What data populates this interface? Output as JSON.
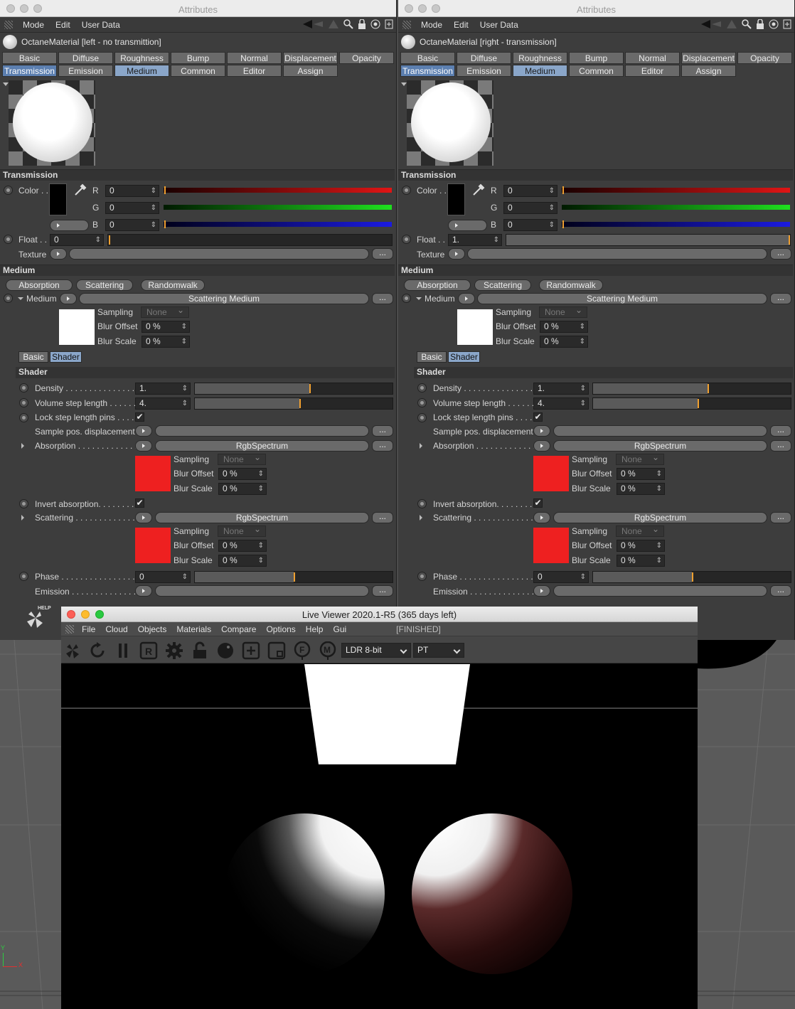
{
  "window_title": "Attributes",
  "menu": [
    "Mode",
    "Edit",
    "User Data"
  ],
  "tabs_row1": [
    "Basic",
    "Diffuse",
    "Roughness",
    "Bump",
    "Normal",
    "Displacement",
    "Opacity"
  ],
  "tabs_row2": [
    "Transmission",
    "Emission",
    "Medium",
    "Common",
    "Editor",
    "Assign"
  ],
  "sections": {
    "transmission": "Transmission",
    "medium": "Medium",
    "shader": "Shader"
  },
  "labels": {
    "color": "Color . .",
    "r": "R",
    "g": "G",
    "b": "B",
    "float": "Float . .",
    "texture": "Texture",
    "medium": "Medium",
    "scattering_medium": "Scattering Medium",
    "sampling": "Sampling",
    "blur_offset": "Blur Offset",
    "blur_scale": "Blur Scale",
    "none": "None",
    "pct0": "0 %",
    "density": "Density . . . . . . . . . . . . . . . .",
    "volume_step": "Volume step length . . . . . .",
    "lock_step": "Lock step length pins . . . .",
    "sample_pos": "Sample pos. displacement",
    "absorption": "Absorption . . . . . . . . . . . . .",
    "invert_absorption": "Invert absorption. . . . . . . .",
    "scattering": "Scattering . . . . . . . . . . . . .",
    "rgbspectrum": "RgbSpectrum",
    "phase": "Phase . . . . . . . . . . . . . . . . .",
    "emission": "Emission . . . . . . . . . . . . . . .",
    "dots": "...",
    "checkmark": "✔",
    "help": "HELP"
  },
  "medium_buttons": [
    "Absorption",
    "Scattering",
    "Randomwalk"
  ],
  "shader_tabs": [
    "Basic",
    "Shader"
  ],
  "left": {
    "object": "OctaneMaterial [left - no transmittion]",
    "r": "0",
    "g": "0",
    "b": "0",
    "float": "0",
    "float_level": 0,
    "density": "1.",
    "density_level": 0.58,
    "volume_step": "4.",
    "volume_step_level": 0.53,
    "phase": "0",
    "phase_level": 0.5
  },
  "right": {
    "object": "OctaneMaterial [right - transmission]",
    "r": "0",
    "g": "0",
    "b": "0",
    "float": "1.",
    "float_level": 1,
    "density": "1.",
    "density_level": 0.58,
    "volume_step": "4.",
    "volume_step_level": 0.53,
    "phase": "0",
    "phase_level": 0.5
  },
  "live_viewer": {
    "title": "Live Viewer 2020.1-R5 (365 days left)",
    "menu": [
      "File",
      "Cloud",
      "Objects",
      "Materials",
      "Compare",
      "Options",
      "Help",
      "Gui"
    ],
    "status": "[FINISHED]",
    "tonemap": "LDR 8-bit",
    "kernel": "PT",
    "icons": [
      "octane-logo-icon",
      "refresh-icon",
      "pause-icon",
      "region-render-icon",
      "settings-gear-icon",
      "lock-icon",
      "material-ball-icon",
      "add-region-icon",
      "crop-icon",
      "focus-picker-icon",
      "material-picker-icon"
    ]
  },
  "axis": {
    "y": "Y",
    "x": "X"
  },
  "colors": {
    "accent_tab": "#8aa6c9",
    "slider_marker": "#f0a030",
    "swatch_red": "#ee2020"
  }
}
